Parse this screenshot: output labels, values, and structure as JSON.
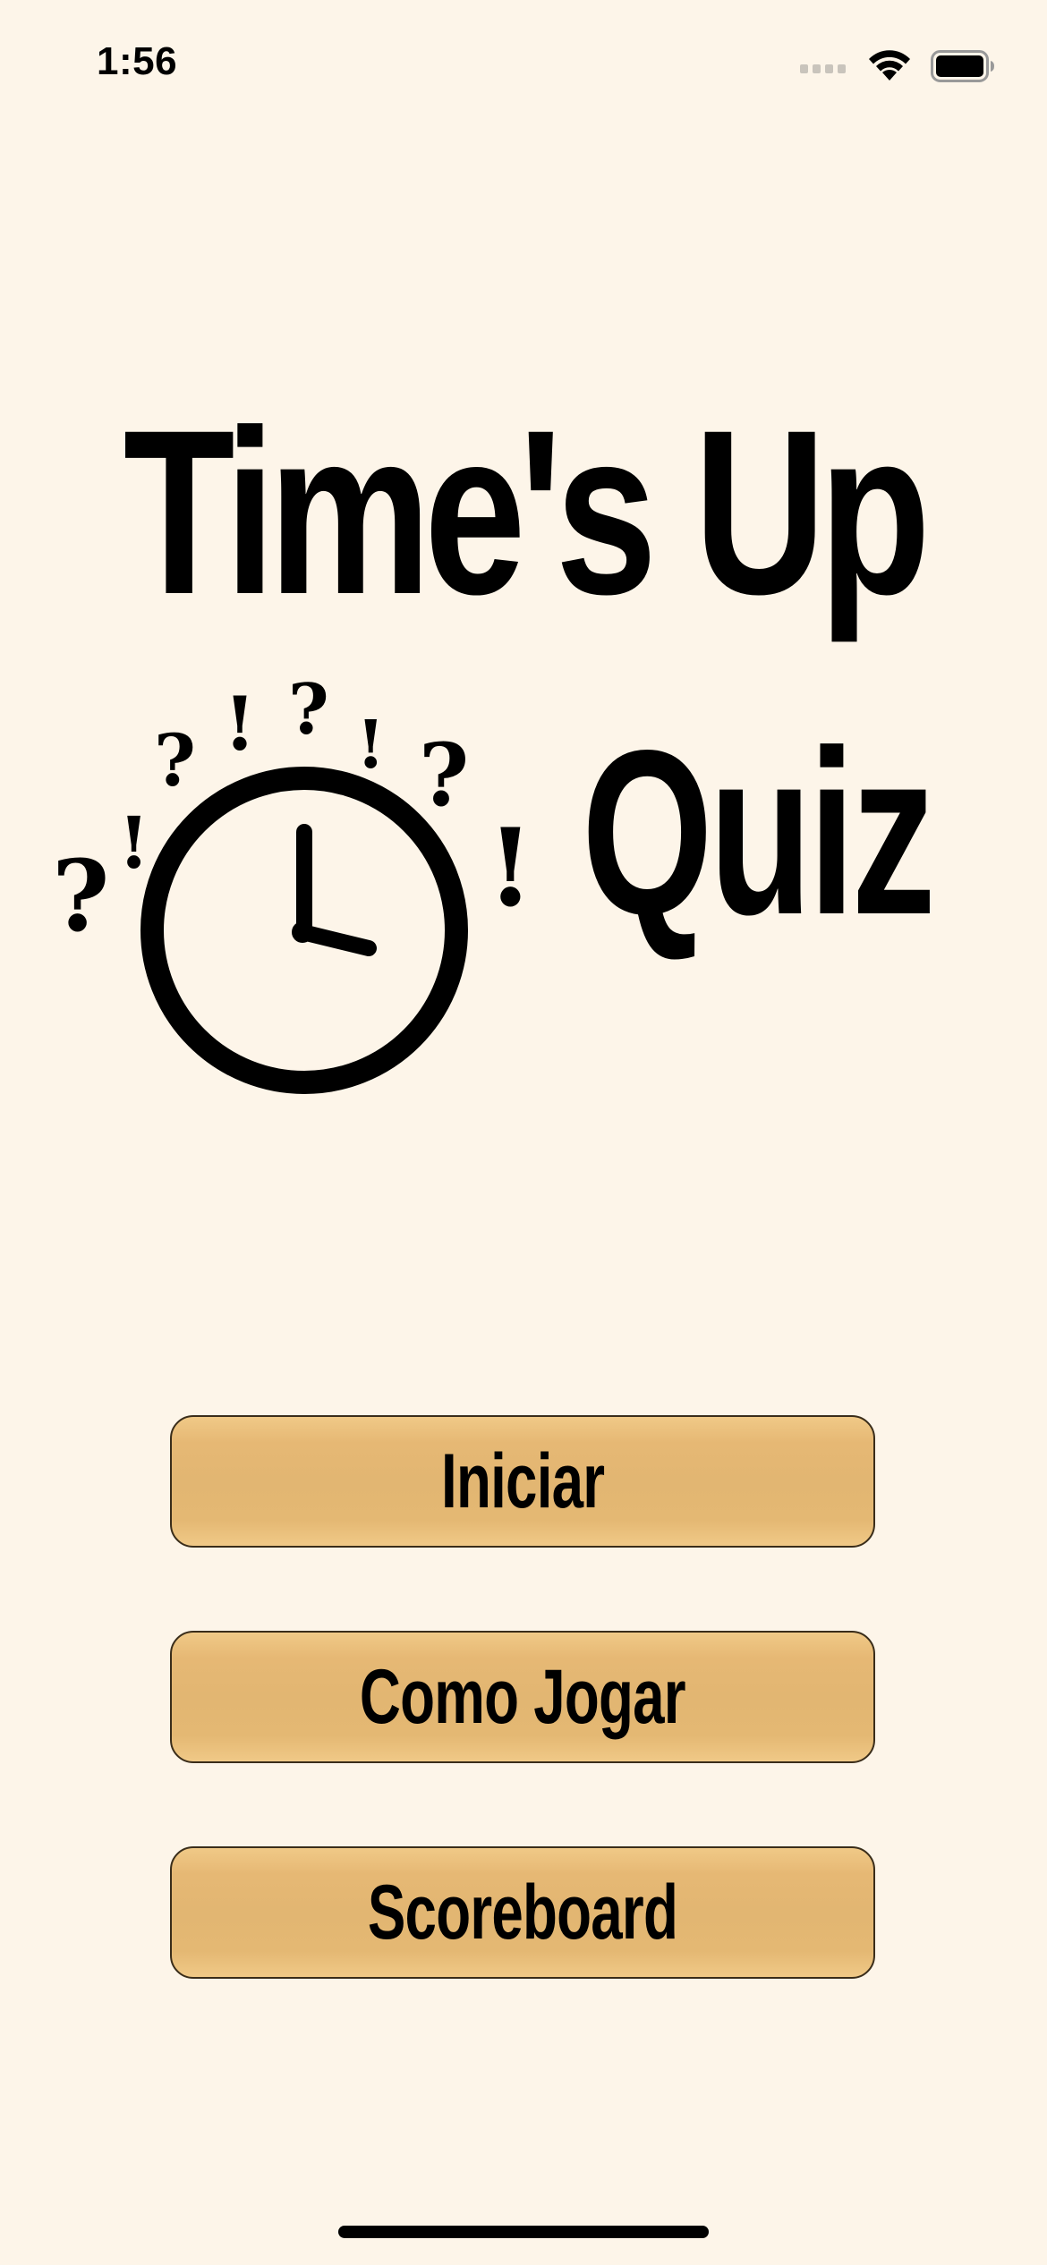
{
  "status_bar": {
    "time": "1:56",
    "icons": [
      "cellular-signal-icon",
      "wifi-icon",
      "battery-icon"
    ]
  },
  "app": {
    "title_line1": "Time's Up",
    "title_line2": "Quiz"
  },
  "illustration": {
    "icon": "clock-icon",
    "marks": [
      "?",
      "!",
      "?",
      "!",
      "?",
      "!",
      "?",
      "!"
    ]
  },
  "menu": {
    "start_label": "Iniciar",
    "how_to_play_label": "Como Jogar",
    "scoreboard_label": "Scoreboard"
  },
  "colors": {
    "background": "#fdf5e9",
    "button_fill": "#e4b873",
    "button_border": "#3a2d1a",
    "text": "#000000"
  }
}
